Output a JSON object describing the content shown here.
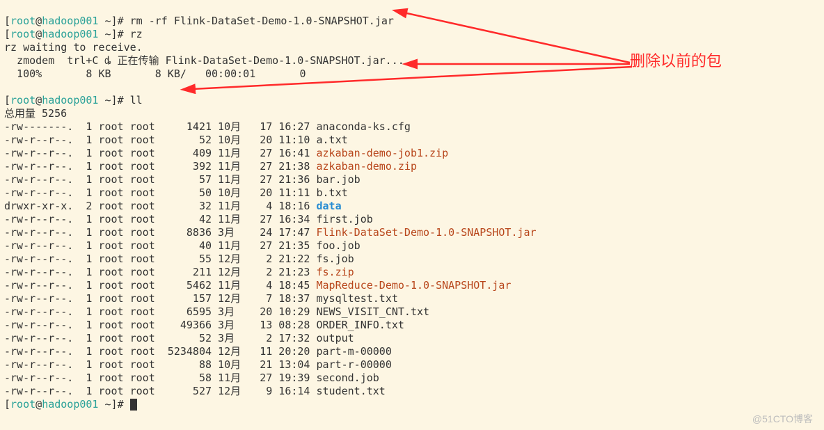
{
  "prompt": {
    "user": "root",
    "host": "hadoop001",
    "cwd": "~",
    "suffix": "#"
  },
  "cmd1": "rm -rf Flink-DataSet-Demo-1.0-SNAPSHOT.jar",
  "cmd2": "rz",
  "rz_wait": "rz waiting to receive.",
  "zmodem_line": "  zmodem  trl+C ȡ 正在传输 Flink-DataSet-Demo-1.0-SNAPSHOT.jar...",
  "progress": "  100%       8 KB       8 KB/   00:00:01       0",
  "cmd3": "ll",
  "ll_header": "总用量 5256",
  "files": [
    {
      "perm": "-rw-------.",
      "links": "1",
      "owner": "root",
      "group": "root",
      "size": "1421",
      "mon": "10月",
      "day": "17",
      "time": "16:27",
      "name": "anaconda-ks.cfg",
      "cls": ""
    },
    {
      "perm": "-rw-r--r--.",
      "links": "1",
      "owner": "root",
      "group": "root",
      "size": "52",
      "mon": "10月",
      "day": "20",
      "time": "11:10",
      "name": "a.txt",
      "cls": ""
    },
    {
      "perm": "-rw-r--r--.",
      "links": "1",
      "owner": "root",
      "group": "root",
      "size": "409",
      "mon": "11月",
      "day": "27",
      "time": "16:41",
      "name": "azkaban-demo-job1.zip",
      "cls": "fn-red"
    },
    {
      "perm": "-rw-r--r--.",
      "links": "1",
      "owner": "root",
      "group": "root",
      "size": "392",
      "mon": "11月",
      "day": "27",
      "time": "21:38",
      "name": "azkaban-demo.zip",
      "cls": "fn-red"
    },
    {
      "perm": "-rw-r--r--.",
      "links": "1",
      "owner": "root",
      "group": "root",
      "size": "57",
      "mon": "11月",
      "day": "27",
      "time": "21:36",
      "name": "bar.job",
      "cls": ""
    },
    {
      "perm": "-rw-r--r--.",
      "links": "1",
      "owner": "root",
      "group": "root",
      "size": "50",
      "mon": "10月",
      "day": "20",
      "time": "11:11",
      "name": "b.txt",
      "cls": ""
    },
    {
      "perm": "drwxr-xr-x.",
      "links": "2",
      "owner": "root",
      "group": "root",
      "size": "32",
      "mon": "11月",
      "day": "4",
      "time": "18:16",
      "name": "data",
      "cls": "fn-blue"
    },
    {
      "perm": "-rw-r--r--.",
      "links": "1",
      "owner": "root",
      "group": "root",
      "size": "42",
      "mon": "11月",
      "day": "27",
      "time": "16:34",
      "name": "first.job",
      "cls": ""
    },
    {
      "perm": "-rw-r--r--.",
      "links": "1",
      "owner": "root",
      "group": "root",
      "size": "8836",
      "mon": "3月",
      "day": "24",
      "time": "17:47",
      "name": "Flink-DataSet-Demo-1.0-SNAPSHOT.jar",
      "cls": "fn-red"
    },
    {
      "perm": "-rw-r--r--.",
      "links": "1",
      "owner": "root",
      "group": "root",
      "size": "40",
      "mon": "11月",
      "day": "27",
      "time": "21:35",
      "name": "foo.job",
      "cls": ""
    },
    {
      "perm": "-rw-r--r--.",
      "links": "1",
      "owner": "root",
      "group": "root",
      "size": "55",
      "mon": "12月",
      "day": "2",
      "time": "21:22",
      "name": "fs.job",
      "cls": ""
    },
    {
      "perm": "-rw-r--r--.",
      "links": "1",
      "owner": "root",
      "group": "root",
      "size": "211",
      "mon": "12月",
      "day": "2",
      "time": "21:23",
      "name": "fs.zip",
      "cls": "fn-red"
    },
    {
      "perm": "-rw-r--r--.",
      "links": "1",
      "owner": "root",
      "group": "root",
      "size": "5462",
      "mon": "11月",
      "day": "4",
      "time": "18:45",
      "name": "MapReduce-Demo-1.0-SNAPSHOT.jar",
      "cls": "fn-red"
    },
    {
      "perm": "-rw-r--r--.",
      "links": "1",
      "owner": "root",
      "group": "root",
      "size": "157",
      "mon": "12月",
      "day": "7",
      "time": "18:37",
      "name": "mysqltest.txt",
      "cls": ""
    },
    {
      "perm": "-rw-r--r--.",
      "links": "1",
      "owner": "root",
      "group": "root",
      "size": "6595",
      "mon": "3月",
      "day": "20",
      "time": "10:29",
      "name": "NEWS_VISIT_CNT.txt",
      "cls": ""
    },
    {
      "perm": "-rw-r--r--.",
      "links": "1",
      "owner": "root",
      "group": "root",
      "size": "49366",
      "mon": "3月",
      "day": "13",
      "time": "08:28",
      "name": "ORDER_INFO.txt",
      "cls": ""
    },
    {
      "perm": "-rw-r--r--.",
      "links": "1",
      "owner": "root",
      "group": "root",
      "size": "52",
      "mon": "3月",
      "day": "2",
      "time": "17:32",
      "name": "output",
      "cls": ""
    },
    {
      "perm": "-rw-r--r--.",
      "links": "1",
      "owner": "root",
      "group": "root",
      "size": "5234804",
      "mon": "12月",
      "day": "11",
      "time": "20:20",
      "name": "part-m-00000",
      "cls": ""
    },
    {
      "perm": "-rw-r--r--.",
      "links": "1",
      "owner": "root",
      "group": "root",
      "size": "88",
      "mon": "10月",
      "day": "21",
      "time": "13:04",
      "name": "part-r-00000",
      "cls": ""
    },
    {
      "perm": "-rw-r--r--.",
      "links": "1",
      "owner": "root",
      "group": "root",
      "size": "58",
      "mon": "11月",
      "day": "27",
      "time": "19:39",
      "name": "second.job",
      "cls": ""
    },
    {
      "perm": "-rw-r--r--.",
      "links": "1",
      "owner": "root",
      "group": "root",
      "size": "527",
      "mon": "12月",
      "day": "9",
      "time": "16:14",
      "name": "student.txt",
      "cls": ""
    }
  ],
  "annotation": "删除以前的包",
  "watermark": "@51CTO博客"
}
